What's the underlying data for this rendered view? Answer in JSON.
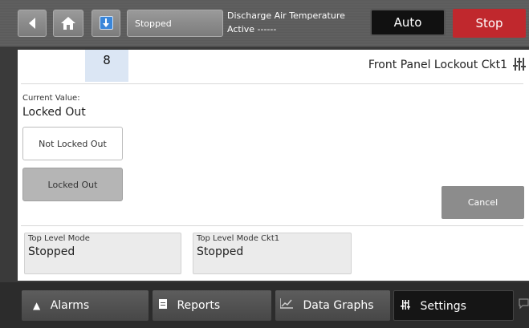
{
  "topbar": {
    "status_label": "Stopped",
    "discharge_title": "Discharge Air Temperature",
    "discharge_value": "Active ------",
    "auto_label": "Auto",
    "stop_label": "Stop"
  },
  "panel": {
    "tab_number": "8",
    "title": "Front Panel Lockout Ckt1",
    "current_value_label": "Current Value:",
    "current_value": "Locked Out",
    "options": [
      "Not Locked Out",
      "Locked Out"
    ],
    "selected_option": "Locked Out",
    "cancel_label": "Cancel",
    "cards": [
      {
        "label": "Top Level Mode",
        "value": "Stopped"
      },
      {
        "label": "Top Level Mode Ckt1",
        "value": "Stopped"
      }
    ]
  },
  "nav": {
    "alarms": "Alarms",
    "reports": "Reports",
    "data_graphs": "Data Graphs",
    "settings": "Settings"
  },
  "icons": {
    "back": "back-arrow-icon",
    "home": "home-icon",
    "download": "download-arrow-icon",
    "settings": "settings-sliders-icon",
    "bell": "bell-icon",
    "document": "document-icon",
    "chart": "chart-icon",
    "chat": "chat-icon"
  },
  "colors": {
    "stop_button": "#c0282d",
    "tab_highlight": "#dbe6f4",
    "download_blue": "#3a86d9"
  }
}
